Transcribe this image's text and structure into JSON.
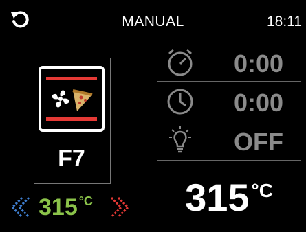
{
  "header": {
    "title": "MANUAL",
    "time": "18:11",
    "back_icon": "undo-arrow-icon"
  },
  "mode": {
    "code": "F7",
    "icon": "fan-pizza-icon",
    "accent_color": "#e53935"
  },
  "set_temperature": {
    "value": "315",
    "unit": "°C",
    "color": "#8bc34a",
    "decrease_icon": "chevron-left-icon",
    "increase_icon": "chevron-right-icon"
  },
  "stats": {
    "timer_value": "0:00",
    "timer_icon": "stopwatch-icon",
    "delay_value": "0:00",
    "delay_icon": "clock-icon",
    "light_value": "OFF",
    "light_icon": "light-bulb-icon"
  },
  "current_temperature": {
    "value": "315",
    "unit": "°C"
  }
}
